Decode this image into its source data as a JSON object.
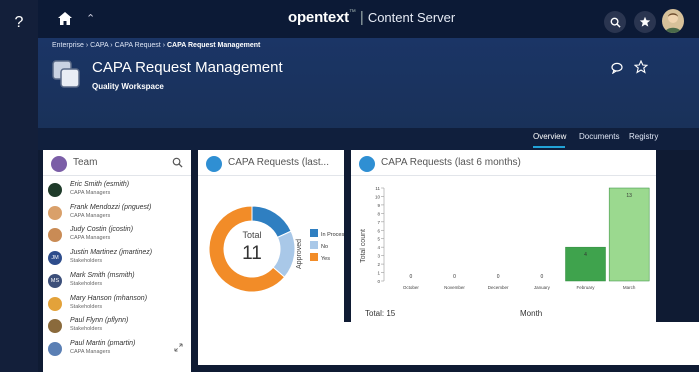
{
  "app": {
    "help_label": "?",
    "brand_logo": "opentext",
    "brand_mark": "™",
    "brand_sep": "|",
    "product": "Content Server"
  },
  "breadcrumb": [
    "Enterprise",
    "CAPA",
    "CAPA Request",
    "CAPA Request Management"
  ],
  "breadcrumb_sep": "›",
  "workspace": {
    "title": "CAPA Request Management",
    "subtitle": "Quality Workspace"
  },
  "tabs": [
    {
      "label": "Overview",
      "active": true
    },
    {
      "label": "Documents",
      "active": false
    },
    {
      "label": "Registry",
      "active": false
    }
  ],
  "team": {
    "title": "Team",
    "members": [
      {
        "name": "Eric Smith (esmith)",
        "role": "CAPA Managers",
        "avatar": "#1f3b2a"
      },
      {
        "name": "Frank Mendozzi (pnguest)",
        "role": "CAPA Managers",
        "avatar": "#d9a06a"
      },
      {
        "name": "Judy Costin (jcostin)",
        "role": "CAPA Managers",
        "avatar": "#c98b55"
      },
      {
        "name": "Justin Martinez (jmartinez)",
        "role": "Stakeholders",
        "avatar": "#2e4d8c",
        "initials": "JM"
      },
      {
        "name": "Mark Smith (msmith)",
        "role": "Stakeholders",
        "avatar": "#3c4f7a",
        "initials": "MS"
      },
      {
        "name": "Mary Hanson (mhanson)",
        "role": "Stakeholders",
        "avatar": "#e3a23a"
      },
      {
        "name": "Paul Flynn (pflynn)",
        "role": "Stakeholders",
        "avatar": "#8a6a3c"
      },
      {
        "name": "Paul Martin (pmartin)",
        "role": "CAPA Managers",
        "avatar": "#5a7fb4"
      }
    ]
  },
  "chart_data": [
    {
      "type": "pie",
      "title": "CAPA Requests (last...",
      "center_label": "Total",
      "center_value": "11",
      "legend_title": "Approved",
      "legend_position": "right",
      "labels": [
        "In Process",
        "No",
        "Yes"
      ],
      "values": [
        2,
        2,
        7
      ],
      "colors": [
        "#2f7fc1",
        "#a9c8e8",
        "#f28c28"
      ]
    },
    {
      "type": "bar",
      "title": "CAPA Requests (last 6 months)",
      "categories": [
        "October",
        "November",
        "December",
        "January",
        "February",
        "March"
      ],
      "values": [
        0,
        0,
        0,
        0,
        4,
        13
      ],
      "ylabel": "Total count",
      "xlabel": "Month",
      "ylim": [
        0,
        11
      ],
      "yticks": [
        0,
        1,
        2,
        3,
        4,
        5,
        6,
        7,
        8,
        9,
        10,
        11
      ],
      "total_label": "Total: 15",
      "colors": [
        "#3fa34d",
        "#9bd98f"
      ]
    }
  ]
}
